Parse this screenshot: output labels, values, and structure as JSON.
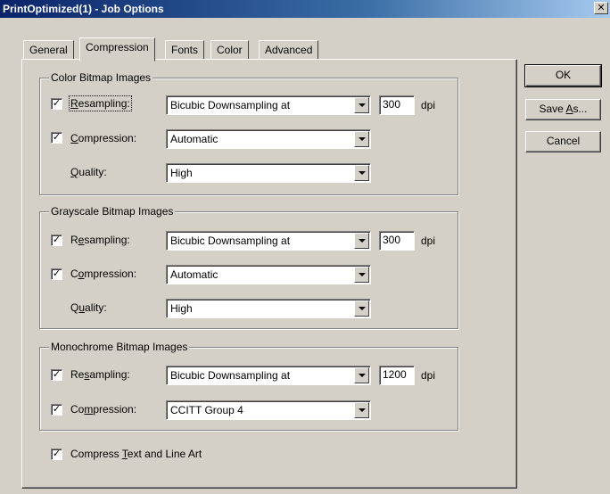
{
  "window": {
    "title": "PrintOptimized(1) - Job Options",
    "close_glyph": "✕"
  },
  "tabs": [
    {
      "label": "General"
    },
    {
      "label": "Compression",
      "active": true
    },
    {
      "label": "Fonts"
    },
    {
      "label": "Color"
    },
    {
      "label": "Advanced"
    }
  ],
  "groups": {
    "color": {
      "title": "Color Bitmap Images",
      "resampling": {
        "checked": true,
        "pre": "",
        "key": "R",
        "post": "esampling:",
        "value": "Bicubic Downsampling at",
        "dpi_value": "300"
      },
      "compression": {
        "checked": true,
        "pre": "",
        "key": "C",
        "post": "ompression:",
        "value": "Automatic"
      },
      "quality": {
        "pre": "",
        "key": "Q",
        "post": "uality:",
        "value": "High"
      }
    },
    "grayscale": {
      "title": "Grayscale Bitmap Images",
      "resampling": {
        "checked": true,
        "pre": "R",
        "key": "e",
        "post": "sampling:",
        "value": "Bicubic Downsampling at",
        "dpi_value": "300"
      },
      "compression": {
        "checked": true,
        "pre": "C",
        "key": "o",
        "post": "mpression:",
        "value": "Automatic"
      },
      "quality": {
        "pre": "Q",
        "key": "u",
        "post": "ality:",
        "value": "High"
      }
    },
    "mono": {
      "title": "Monochrome Bitmap Images",
      "resampling": {
        "checked": true,
        "pre": "Re",
        "key": "s",
        "post": "ampling:",
        "value": "Bicubic Downsampling at",
        "dpi_value": "1200"
      },
      "compression": {
        "checked": true,
        "pre": "Co",
        "key": "m",
        "post": "pression:",
        "value": "CCITT Group 4"
      }
    }
  },
  "dpi_unit": "dpi",
  "compress_text": {
    "checked": true,
    "pre": "Compress ",
    "key": "T",
    "post": "ext and Line Art"
  },
  "buttons": {
    "ok": {
      "label": "OK"
    },
    "save_as": {
      "pre": "Save ",
      "key": "A",
      "post": "s..."
    },
    "cancel": {
      "label": "Cancel"
    }
  },
  "check_glyph": "✓"
}
